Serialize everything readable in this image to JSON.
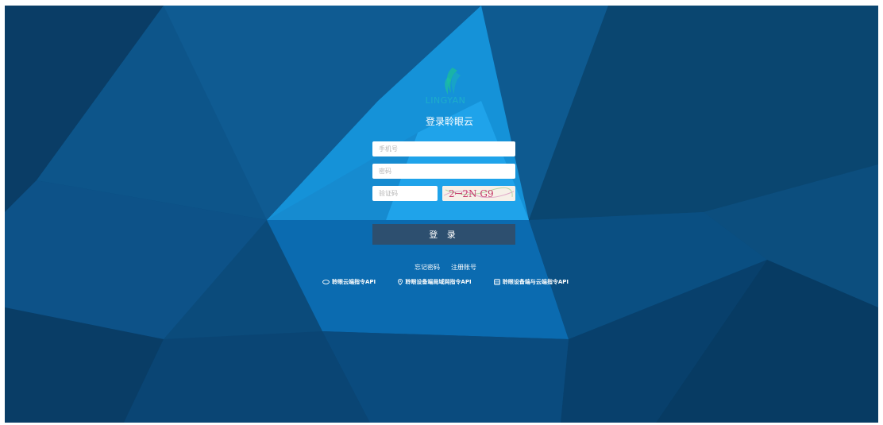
{
  "brand": {
    "logo_text": "LINGYAN"
  },
  "login": {
    "title": "登录聆眼云",
    "phone_placeholder": "手机号",
    "password_placeholder": "密码",
    "captcha_placeholder": "验证码",
    "captcha_text": "2ꟷ2N G9",
    "submit_label": "登 录"
  },
  "links": {
    "forgot_password": "忘记密码",
    "register": "注册账号"
  },
  "api_links": [
    {
      "label": "聆眼云端指令API",
      "icon": "cloud-icon"
    },
    {
      "label": "聆眼设备端局域网指令API",
      "icon": "location-pin-icon"
    },
    {
      "label": "聆眼设备端与云端指令API",
      "icon": "database-icon"
    }
  ]
}
